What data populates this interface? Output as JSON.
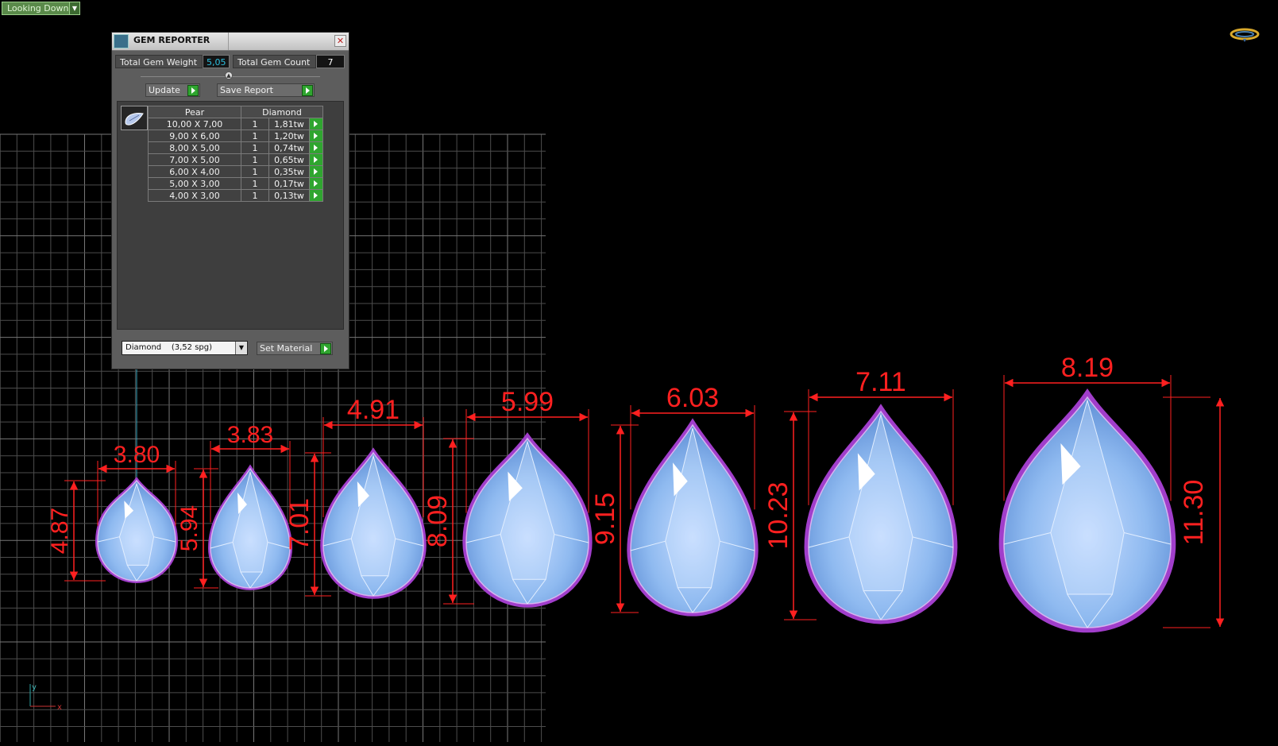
{
  "viewport": {
    "view_mode": "Looking Down",
    "background_color": "#000000",
    "grid_color": "#4d4d4d",
    "gem_colors": {
      "fill": "#8fbaf0",
      "setting": "#a13ecb",
      "dimension": "#ff2020"
    }
  },
  "panel": {
    "title": "GEM REPORTER",
    "total_weight_label": "Total Gem Weight",
    "total_weight_value": "5,05",
    "total_count_label": "Total Gem Count",
    "total_count_value": "7",
    "update_label": "Update",
    "save_report_label": "Save Report",
    "table_headers": [
      "Pear",
      "Diamond"
    ],
    "rows": [
      {
        "size": "10,00 X 7,00",
        "count": "1",
        "weight": "1,81tw"
      },
      {
        "size": "9,00 X 6,00",
        "count": "1",
        "weight": "1,20tw"
      },
      {
        "size": "8,00 X 5,00",
        "count": "1",
        "weight": "0,74tw"
      },
      {
        "size": "7,00 X 5,00",
        "count": "1",
        "weight": "0,65tw"
      },
      {
        "size": "6,00 X 4,00",
        "count": "1",
        "weight": "0,35tw"
      },
      {
        "size": "5,00 X 3,00",
        "count": "1",
        "weight": "0,17tw"
      },
      {
        "size": "4,00 X 3,00",
        "count": "1",
        "weight": "0,13tw"
      }
    ],
    "material_value": "Diamond    (3,52 spg)",
    "set_material_label": "Set Material"
  },
  "gems": [
    {
      "width": "3.80",
      "height": "4.87"
    },
    {
      "width": "3.83",
      "height": "5.94"
    },
    {
      "width": "4.91",
      "height": "7.01"
    },
    {
      "width": "5.99",
      "height": "8.09"
    },
    {
      "width": "6.03",
      "height": "9.15"
    },
    {
      "width": "7.11",
      "height": "10.23"
    },
    {
      "width": "8.19",
      "height": "11.30"
    }
  ],
  "axes": {
    "x": "x",
    "y": "y"
  }
}
